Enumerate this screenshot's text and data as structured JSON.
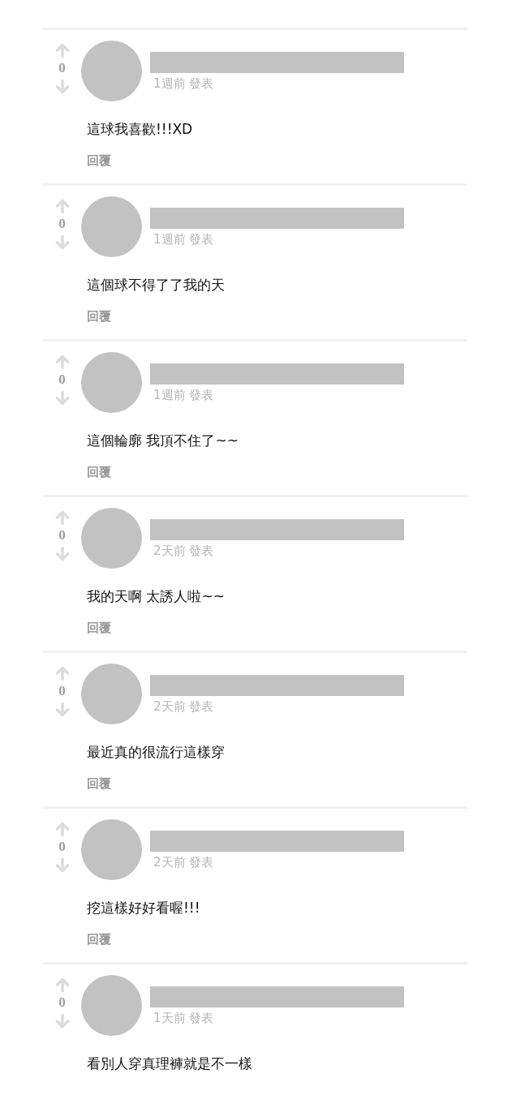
{
  "comments": [
    {
      "votes": "0",
      "time": "1週前 發表",
      "text": "這球我喜歡!!!XD",
      "reply": "回覆"
    },
    {
      "votes": "0",
      "time": "1週前 發表",
      "text": "這個球不得了了我的天",
      "reply": "回覆"
    },
    {
      "votes": "0",
      "time": "1週前 發表",
      "text": "這個輪廓 我頂不住了~~",
      "reply": "回覆"
    },
    {
      "votes": "0",
      "time": "2天前 發表",
      "text": "我的天啊 太誘人啦~~",
      "reply": "回覆"
    },
    {
      "votes": "0",
      "time": "2天前 發表",
      "text": "最近真的很流行這樣穿",
      "reply": "回覆"
    },
    {
      "votes": "0",
      "time": "2天前 發表",
      "text": "挖這樣好好看喔!!!",
      "reply": "回覆"
    },
    {
      "votes": "0",
      "time": "1天前 發表",
      "text": "看別人穿真理褲就是不一樣"
    }
  ]
}
